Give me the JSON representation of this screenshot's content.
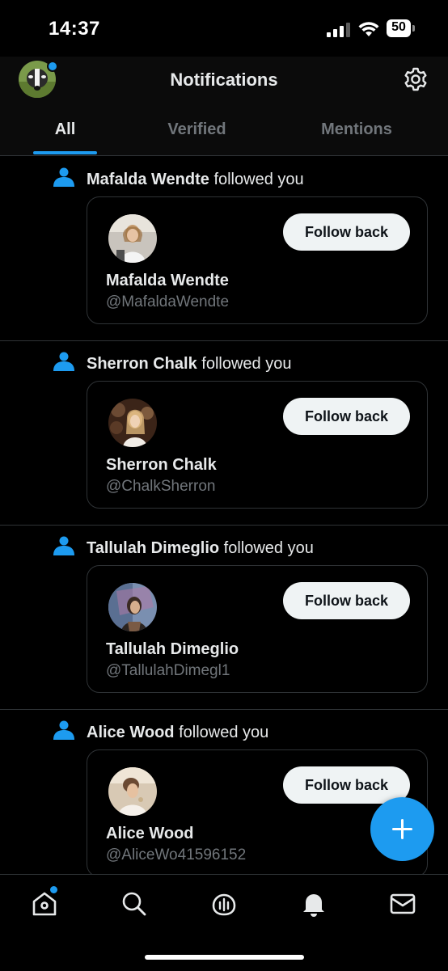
{
  "status": {
    "time": "14:37",
    "battery": "50"
  },
  "header": {
    "title": "Notifications"
  },
  "tabs": [
    {
      "label": "All",
      "active": true
    },
    {
      "label": "Verified",
      "active": false
    },
    {
      "label": "Mentions",
      "active": false
    }
  ],
  "notifications": [
    {
      "name": "Mafalda Wendte",
      "action": "followed you",
      "handle": "@MafaldaWendte",
      "button": "Follow back"
    },
    {
      "name": "Sherron Chalk",
      "action": "followed you",
      "handle": "@ChalkSherron",
      "button": "Follow back"
    },
    {
      "name": "Tallulah Dimeglio",
      "action": "followed you",
      "handle": "@TallulahDimegl1",
      "button": "Follow back"
    },
    {
      "name": "Alice Wood",
      "action": "followed you",
      "handle": "@AliceWo41596152",
      "button": "Follow back"
    }
  ],
  "nav": [
    "home-icon",
    "search-icon",
    "spaces-icon",
    "notifications-icon",
    "messages-icon"
  ],
  "colors": {
    "accent": "#1d9bf0",
    "background": "#000000",
    "muted": "#71767b"
  }
}
